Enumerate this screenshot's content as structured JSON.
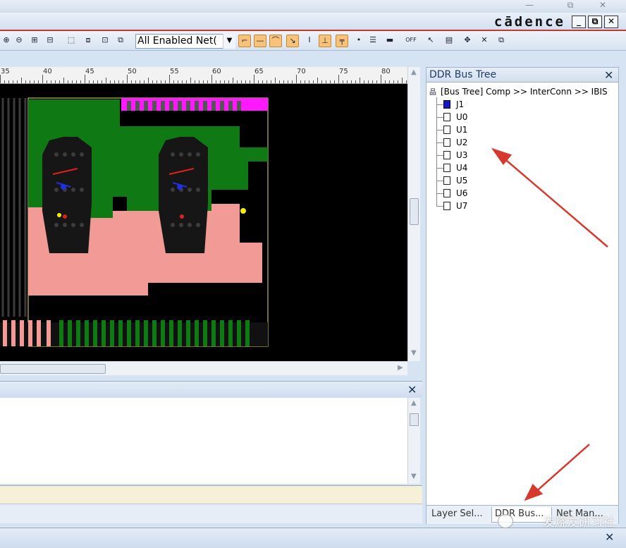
{
  "window": {
    "minimize": "—",
    "restore": "⧉",
    "close": "✕"
  },
  "brand": "cādence",
  "app_buttons": {
    "minimize": "_",
    "restore": "🗗",
    "close": "✕"
  },
  "toolbar": {
    "net_filter_value": "All Enabled Net(",
    "dropdown_arrow": "▼",
    "tools": [
      {
        "icon": "zoom-in-icon",
        "glyph": "⊕"
      },
      {
        "icon": "zoom-out-icon",
        "glyph": "⊖"
      },
      {
        "icon": "zoom-area-icon",
        "glyph": "⊞"
      },
      {
        "icon": "zoom-prev-icon",
        "glyph": "⊟"
      },
      {
        "icon": "zoom-fit-icon",
        "glyph": "⬚"
      },
      {
        "icon": "zoom-select-icon",
        "glyph": "⧈"
      },
      {
        "icon": "zoom-center-icon",
        "glyph": "⊡"
      },
      {
        "icon": "zoom-world-icon",
        "glyph": "⧉"
      },
      {
        "icon": "add-connect-icon",
        "glyph": "⌐"
      },
      {
        "icon": "line-icon",
        "glyph": "—"
      },
      {
        "icon": "arc-icon",
        "glyph": "⌒"
      },
      {
        "icon": "slide-icon",
        "glyph": "↘"
      },
      {
        "icon": "cursor-text-icon",
        "glyph": "I"
      },
      {
        "icon": "spacing-icon",
        "glyph": "⊥"
      },
      {
        "icon": "via-icon",
        "glyph": "╤"
      },
      {
        "icon": "dot-icon",
        "glyph": "•"
      },
      {
        "icon": "list-icon",
        "glyph": "☰"
      },
      {
        "icon": "bus-icon",
        "glyph": "▬"
      },
      {
        "icon": "off-icon",
        "glyph": "OFF"
      },
      {
        "icon": "select-icon",
        "glyph": "↖"
      },
      {
        "icon": "note-icon",
        "glyph": "▤"
      },
      {
        "icon": "move-icon",
        "glyph": "✥"
      },
      {
        "icon": "delete-icon",
        "glyph": "✕"
      },
      {
        "icon": "copy-icon",
        "glyph": "⧉"
      }
    ]
  },
  "ruler": {
    "labels": [
      "35",
      "40",
      "45",
      "50",
      "55",
      "60",
      "65",
      "70",
      "75",
      "80"
    ]
  },
  "ddr_panel": {
    "title": "DDR Bus Tree",
    "close": "✕",
    "root_label": "[Bus Tree] Comp >> InterConn >> IBIS",
    "components": [
      "J1",
      "U0",
      "U1",
      "U2",
      "U3",
      "U4",
      "U5",
      "U6",
      "U7"
    ],
    "selected": "J1",
    "tabs": [
      "Layer Sel...",
      "DDR Bus...",
      "Net Man..."
    ],
    "active_tab": "DDR Bus..."
  },
  "bottom_panel": {
    "close": "✕"
  },
  "bottom_bar": {
    "close": "✕"
  },
  "watermark": "发烧友研习社",
  "colors": {
    "accent_red": "#c0392b",
    "copper_green": "#0f7a13",
    "copper_pink": "#f29a95",
    "magenta": "#ff19ff",
    "board_outline": "#e8e06a",
    "selected_chip": "#1414c8"
  }
}
